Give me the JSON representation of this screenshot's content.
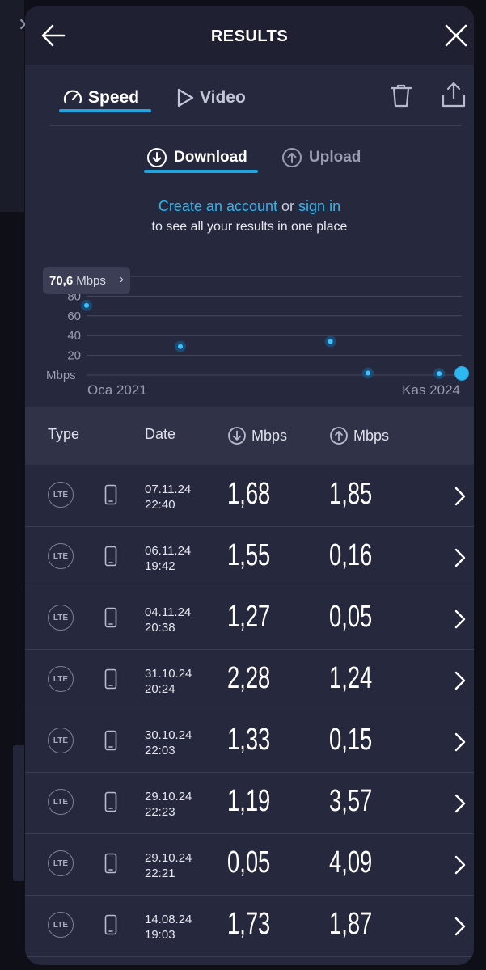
{
  "header": {
    "title": "RESULTS"
  },
  "tabs": {
    "speed": "Speed",
    "video": "Video"
  },
  "subtabs": {
    "download": "Download",
    "upload": "Upload"
  },
  "promo": {
    "create_account": "Create an account",
    "or": "or",
    "sign_in": "sign in",
    "line2": "to see all your results in one place"
  },
  "chart_data": {
    "type": "scatter",
    "ylabel": "Mbps",
    "yticks": [
      20,
      40,
      60,
      80,
      100
    ],
    "ylim": [
      0,
      100
    ],
    "x_start_label": "Oca 2021",
    "x_end_label": "Kas 2024",
    "points": [
      {
        "x": 0.0,
        "y": 70.6
      },
      {
        "x": 0.25,
        "y": 29
      },
      {
        "x": 0.65,
        "y": 34
      },
      {
        "x": 0.75,
        "y": 2
      },
      {
        "x": 0.94,
        "y": 1.5
      },
      {
        "x": 1.0,
        "y": 1.7
      }
    ],
    "tooltip": {
      "value": "70,6",
      "unit": "Mbps"
    },
    "color": "#1ea6e0"
  },
  "table": {
    "headers": {
      "type": "Type",
      "date": "Date",
      "download": "Mbps",
      "upload": "Mbps"
    },
    "rows": [
      {
        "type": "LTE",
        "date": "07.11.24",
        "time": "22:40",
        "download": "1,68",
        "upload": "1,85"
      },
      {
        "type": "LTE",
        "date": "06.11.24",
        "time": "19:42",
        "download": "1,55",
        "upload": "0,16"
      },
      {
        "type": "LTE",
        "date": "04.11.24",
        "time": "20:38",
        "download": "1,27",
        "upload": "0,05"
      },
      {
        "type": "LTE",
        "date": "31.10.24",
        "time": "20:24",
        "download": "2,28",
        "upload": "1,24"
      },
      {
        "type": "LTE",
        "date": "30.10.24",
        "time": "22:03",
        "download": "1,33",
        "upload": "0,15"
      },
      {
        "type": "LTE",
        "date": "29.10.24",
        "time": "22:23",
        "download": "1,19",
        "upload": "3,57"
      },
      {
        "type": "LTE",
        "date": "29.10.24",
        "time": "22:21",
        "download": "0,05",
        "upload": "4,09"
      },
      {
        "type": "LTE",
        "date": "14.08.24",
        "time": "19:03",
        "download": "1,73",
        "upload": "1,87"
      }
    ]
  },
  "colors": {
    "accent": "#1ea6e0",
    "panel": "#26283d",
    "header_row": "#303248"
  }
}
